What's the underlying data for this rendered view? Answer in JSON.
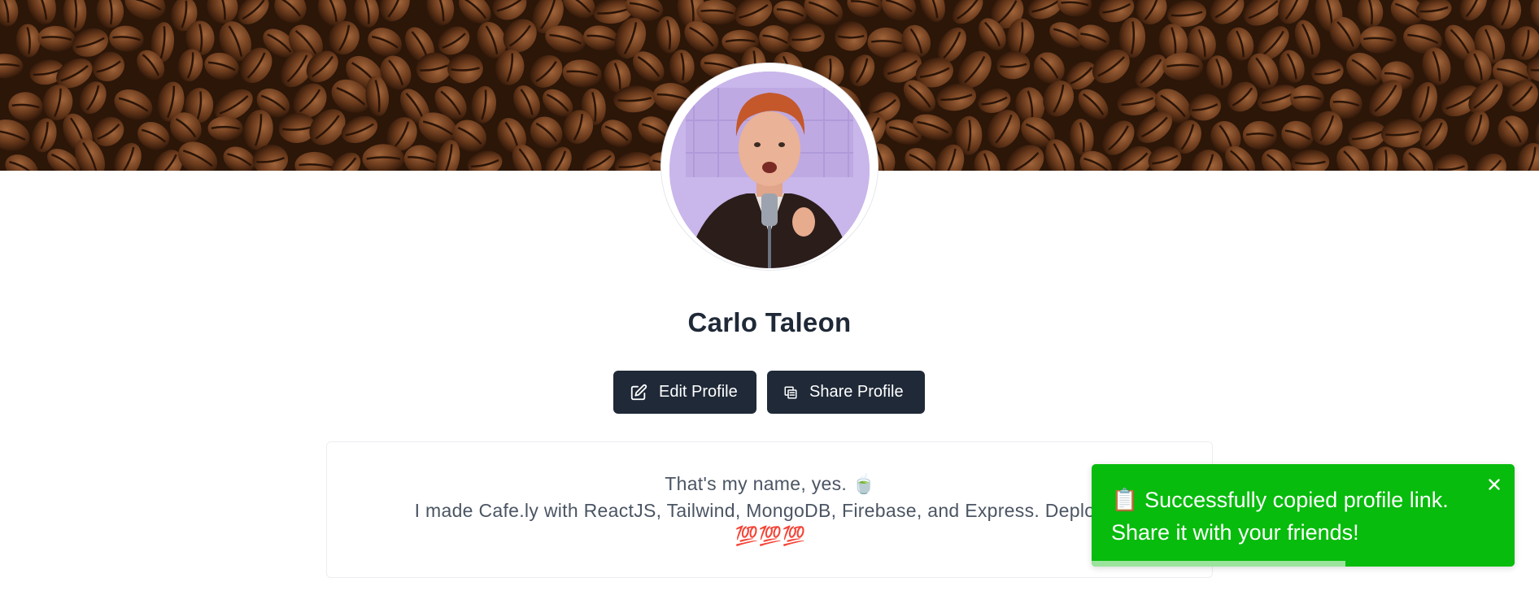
{
  "profile": {
    "name": "Carlo Taleon"
  },
  "actions": {
    "edit_label": "Edit Profile",
    "share_label": "Share Profile"
  },
  "bio": {
    "line1": "That's my name, yes. 🍵",
    "line2": "I made Cafe.ly with ReactJS, Tailwind, MongoDB, Firebase, and Express. Deployed",
    "line3": "💯💯💯"
  },
  "toast": {
    "message_line1": "📋 Successfully copied profile link.",
    "message_line2": "Share it with your friends!",
    "close_icon": "close-icon",
    "progress": 0.6,
    "color": "#07bc0c"
  },
  "icons": {
    "edit": "edit-icon",
    "share": "copy-icon"
  },
  "colors": {
    "button_bg": "#1f2937",
    "name_text": "#1f2937",
    "bio_text": "#4b5563"
  }
}
